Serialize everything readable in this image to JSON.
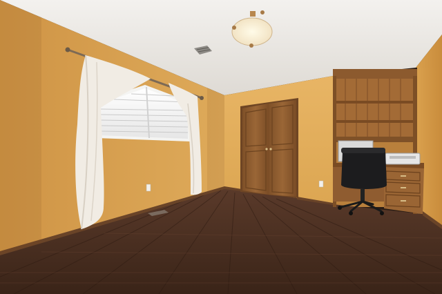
{
  "scene": {
    "colors": {
      "ceiling": "#ece9e4",
      "wall_left": "#d9a24f",
      "wall_back": "#e2ad5c",
      "wall_right": "#d69b47",
      "floor": "#4a2f22",
      "door": "#8a5a2f",
      "cabinet": "#8f5e32",
      "curtain": "#f1ece4",
      "chair": "#1c1c1e"
    },
    "icons": [
      "ceiling-light-icon",
      "air-vent-icon",
      "outlet-icon",
      "office-chair-icon",
      "printer-icon"
    ]
  }
}
